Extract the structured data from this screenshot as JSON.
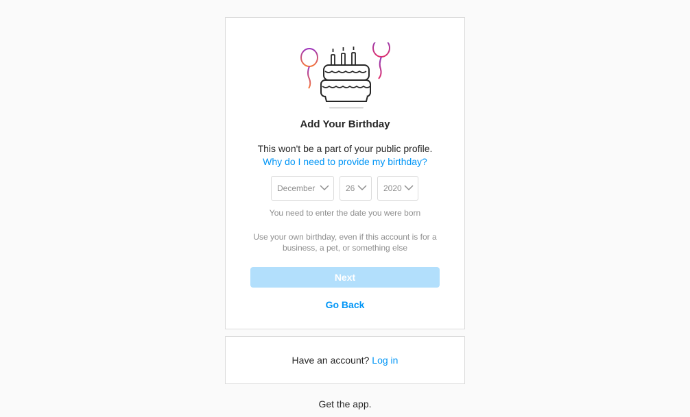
{
  "signup": {
    "title": "Add Your Birthday",
    "subtitle": "This won't be a part of your public profile.",
    "why_link": "Why do I need to provide my birthday?",
    "birthday": {
      "month": "December",
      "day": "26",
      "year": "2020"
    },
    "hint": "You need to enter the date you were born",
    "note": "Use your own birthday, even if this account is for a business, a pet, or something else",
    "next_label": "Next",
    "go_back_label": "Go Back"
  },
  "login_prompt": {
    "text": "Have an account?",
    "link": "Log in"
  },
  "footer": {
    "get_app": "Get the app."
  },
  "colors": {
    "link": "#0095f6",
    "next_disabled": "#b2dffc",
    "border": "#dbdbdb",
    "background": "#fafafa"
  },
  "icons": {
    "illustration": "birthday-cake-balloons-icon",
    "select_chevron": "chevron-down-icon"
  }
}
